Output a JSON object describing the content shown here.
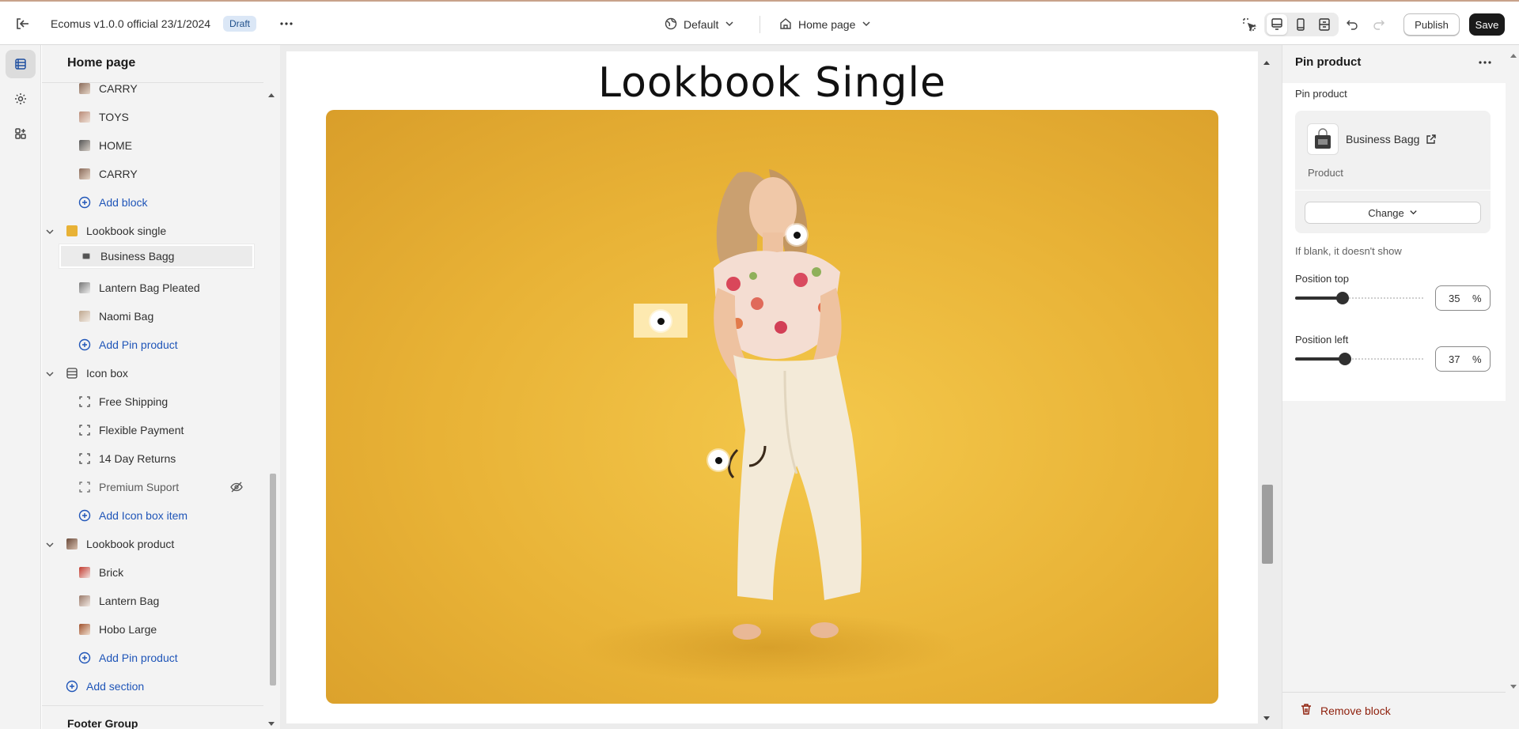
{
  "topbar": {
    "title": "Ecomus v1.0.0 official 23/1/2024",
    "badge": "Draft",
    "theme_label": "Default",
    "page_label": "Home page",
    "publish_label": "Publish",
    "save_label": "Save"
  },
  "tree": {
    "title": "Home page",
    "rows": [
      {
        "label": "CARRY"
      },
      {
        "label": "TOYS"
      },
      {
        "label": "HOME"
      },
      {
        "label": "CARRY"
      },
      {
        "label": "Add block"
      },
      {
        "label": "Lookbook single"
      },
      {
        "label": "Business Bagg"
      },
      {
        "label": "Lantern Bag Pleated"
      },
      {
        "label": "Naomi Bag"
      },
      {
        "label": "Add Pin product"
      },
      {
        "label": "Icon box"
      },
      {
        "label": "Free Shipping"
      },
      {
        "label": "Flexible Payment"
      },
      {
        "label": "14 Day Returns"
      },
      {
        "label": "Premium Suport"
      },
      {
        "label": "Add Icon box item"
      },
      {
        "label": "Lookbook product"
      },
      {
        "label": "Brick"
      },
      {
        "label": "Lantern Bag"
      },
      {
        "label": "Hobo Large"
      },
      {
        "label": "Add Pin product"
      },
      {
        "label": "Add section"
      }
    ],
    "footer_group": "Footer Group"
  },
  "canvas": {
    "heading": "Lookbook Single"
  },
  "settings": {
    "title": "Pin product",
    "field_label": "Pin product",
    "product_name": "Business Bagg",
    "product_type": "Product",
    "change_label": "Change",
    "hint": "If blank, it doesn't show",
    "position_top_label": "Position top",
    "position_top_value": "35",
    "position_top_fraction": 0.35,
    "position_left_label": "Position left",
    "position_left_value": "37",
    "position_left_fraction": 0.37,
    "unit": "%",
    "remove_label": "Remove block"
  },
  "colors": {
    "accent_link": "#1f55b8",
    "danger": "#8e1f0b",
    "save_button": "#1a1a1a",
    "lookbook_background": "#e8b236"
  }
}
